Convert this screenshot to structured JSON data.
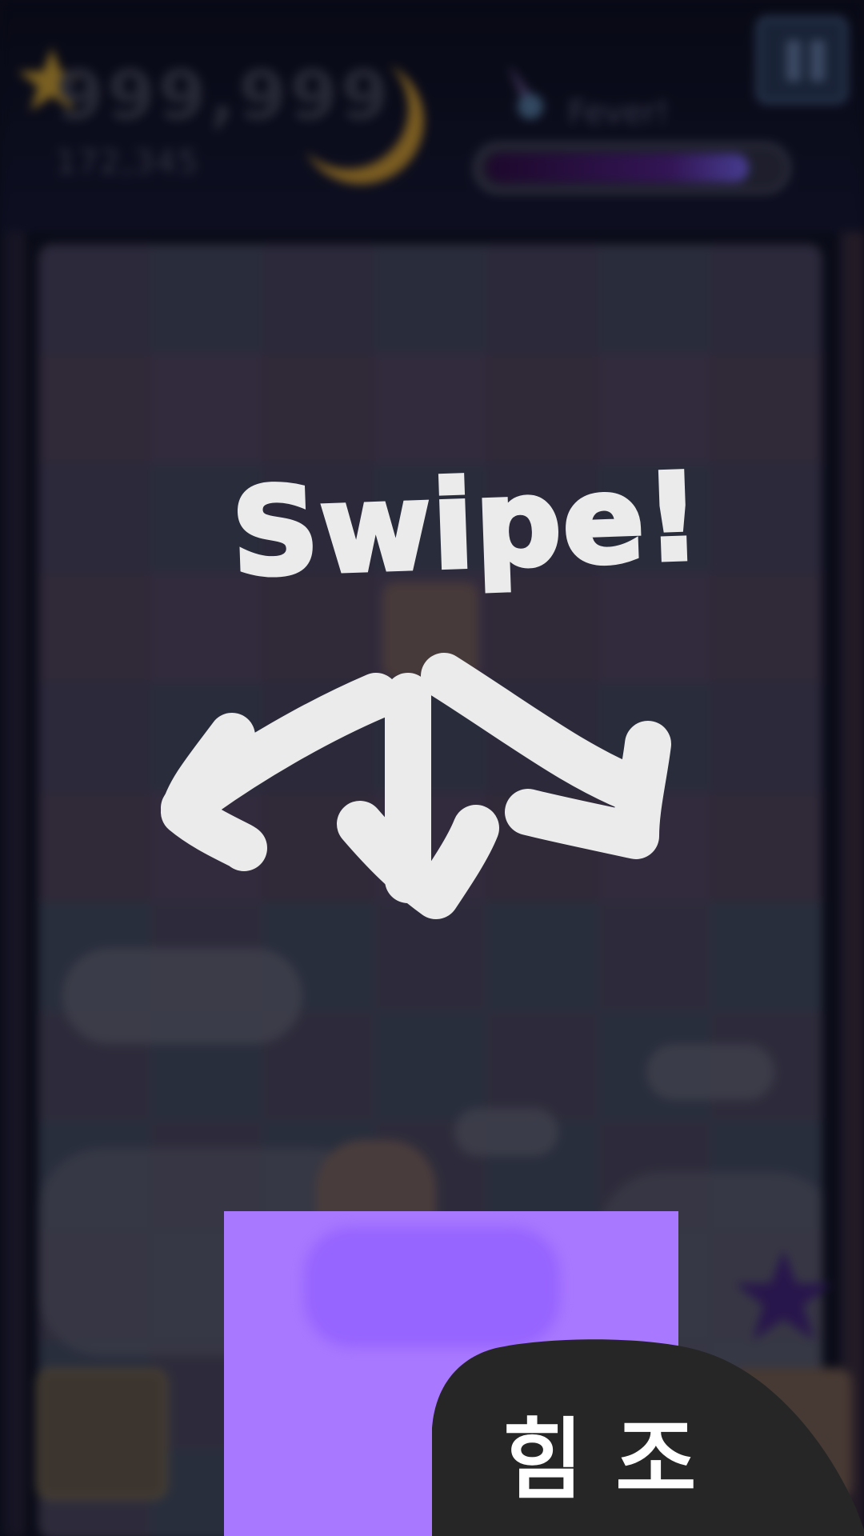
{
  "hud": {
    "score": "999,999",
    "subscore": "172,345",
    "fever_label": "Fever!",
    "fever_progress": 0.9
  },
  "tutorial": {
    "swipe_text": "Swipe!",
    "tip_text": "힘조",
    "arrows": [
      "down-left",
      "down",
      "down-right"
    ]
  },
  "colors": {
    "highlight": "#a878ff",
    "hint_white": "#ebebeb",
    "bubble": "#262626"
  }
}
